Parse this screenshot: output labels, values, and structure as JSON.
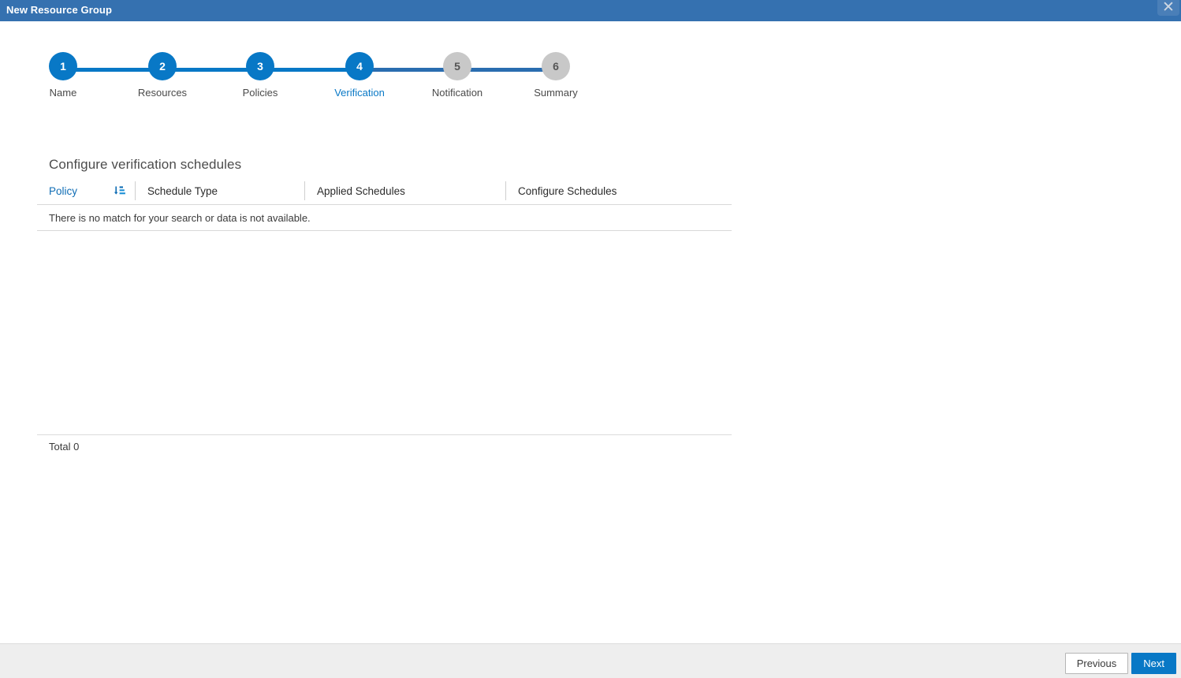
{
  "window": {
    "title": "New Resource Group",
    "close_label": "✕",
    "close_icon": "close-icon",
    "titlebar_color": "#3571b0"
  },
  "colors": {
    "accent": "#0878c6",
    "connector_done": "#0878c6",
    "connector_pending": "#2a6db0",
    "circle_inactive": "#c8c8c8",
    "footer_bg": "#eeeeee"
  },
  "stepper": {
    "steps": [
      {
        "number": "1",
        "label": "Name",
        "state": "done"
      },
      {
        "number": "2",
        "label": "Resources",
        "state": "done"
      },
      {
        "number": "3",
        "label": "Policies",
        "state": "done"
      },
      {
        "number": "4",
        "label": "Verification",
        "state": "active"
      },
      {
        "number": "5",
        "label": "Notification",
        "state": "todo"
      },
      {
        "number": "6",
        "label": "Summary",
        "state": "todo"
      }
    ]
  },
  "main": {
    "heading": "Configure verification schedules",
    "table": {
      "columns": [
        {
          "label": "Policy",
          "sortable": true,
          "sort_icon": "sort-descending-icon"
        },
        {
          "label": "Schedule Type",
          "sortable": false
        },
        {
          "label": "Applied Schedules",
          "sortable": false
        },
        {
          "label": "Configure Schedules",
          "sortable": false
        }
      ],
      "empty_message": "There is no match for your search or data is not available.",
      "rows": [],
      "total_label": "Total 0"
    }
  },
  "footer": {
    "previous_label": "Previous",
    "next_label": "Next"
  }
}
